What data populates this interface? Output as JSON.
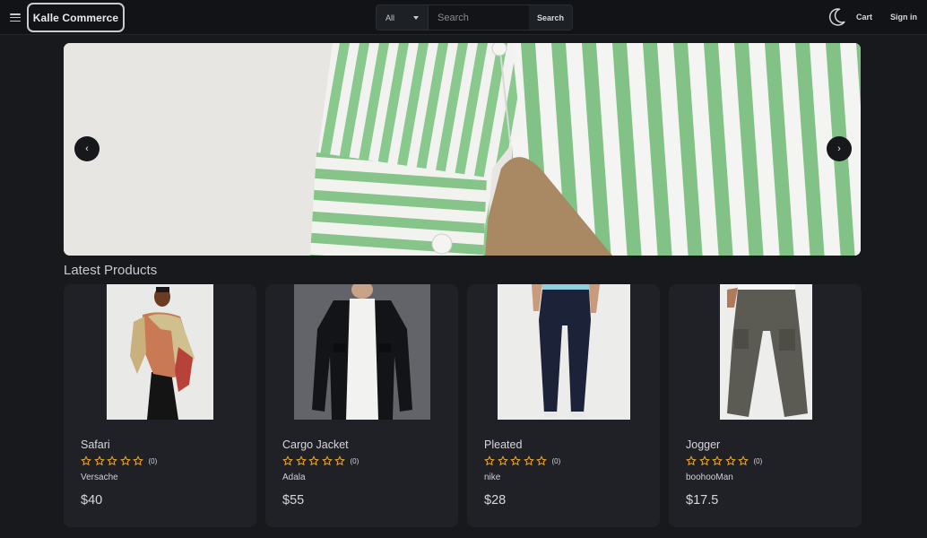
{
  "header": {
    "brand": "Kalle Commerce",
    "search": {
      "category": "All",
      "placeholder": "Search",
      "button_label": "Search"
    },
    "nav": {
      "cart": "Cart",
      "sign_in": "Sign in"
    }
  },
  "carousel": {
    "prev_label": "‹",
    "next_label": "›"
  },
  "section_title": "Latest Products",
  "colors": {
    "background": "#17191d",
    "card": "#1f2126",
    "star": "#f0a82a",
    "header": "#111317"
  },
  "products": [
    {
      "name": "Safari",
      "rating_count": "(0)",
      "brand": "Versache",
      "price": "$40",
      "stars": 0
    },
    {
      "name": "Cargo Jacket",
      "rating_count": "(0)",
      "brand": "Adala",
      "price": "$55",
      "stars": 0
    },
    {
      "name": "Pleated",
      "rating_count": "(0)",
      "brand": "nike",
      "price": "$28",
      "stars": 0
    },
    {
      "name": "Jogger",
      "rating_count": "(0)",
      "brand": "boohooMan",
      "price": "$17.5",
      "stars": 0
    }
  ]
}
